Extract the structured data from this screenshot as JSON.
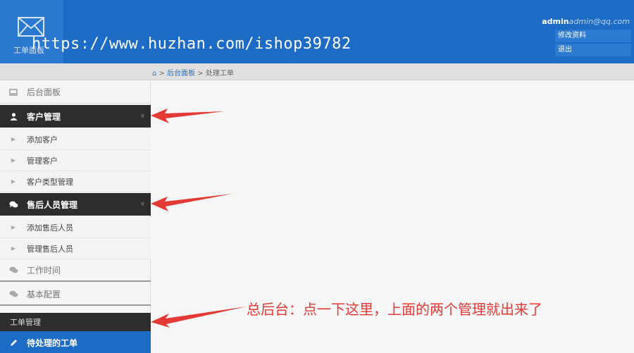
{
  "header": {
    "logo_label": "工单面板",
    "watermark": "https://www.huzhan.com/ishop39782",
    "username": "admin",
    "email": "admin@qq.com",
    "menu": [
      "修改资料",
      "退出"
    ]
  },
  "breadcrumb": {
    "home_icon": "home-icon",
    "items": [
      "后台面板",
      "处理工单"
    ],
    "sep": ">"
  },
  "sidebar": {
    "dashboard": "后台面板",
    "customer_group": "客户管理",
    "customer_items": [
      "添加客户",
      "管理客户",
      "客户类型管理"
    ],
    "aftersales_group": "售后人员管理",
    "aftersales_items": [
      "添加售后人员",
      "管理售后人员"
    ],
    "work_time": "工作时间",
    "basic_config": "基本配置",
    "ticket_section": "工单管理",
    "pending_tickets": "待处理的工单"
  },
  "annotation": {
    "note": "总后台：点一下这里，上面的两个管理就出来了",
    "arrow_color": "#e53935"
  },
  "colors": {
    "brand_blue": "#1c6bc7",
    "dark_menu": "#2d2d2d"
  }
}
